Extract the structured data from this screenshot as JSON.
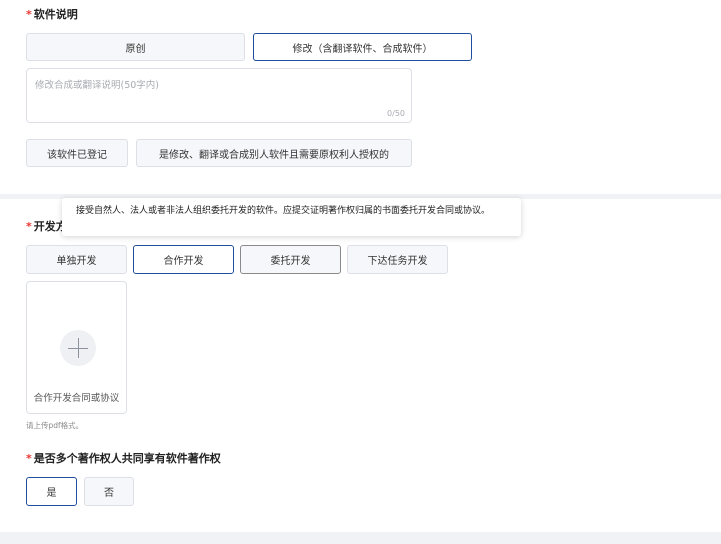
{
  "software_desc": {
    "label": "软件说明",
    "required_mark": "*",
    "options": [
      "原创",
      "修改（含翻译软件、合成软件）"
    ],
    "selected": "修改（含翻译软件、合成软件）",
    "textarea": {
      "placeholder": "修改合成或翻译说明(50字内)",
      "counter": "0/50"
    },
    "extra_options": [
      "该软件已登记",
      "是修改、翻译或合成别人软件且需要原权利人授权的"
    ]
  },
  "dev_method": {
    "label_visible": "开发方",
    "required_mark": "*",
    "tooltip": "接受自然人、法人或者非法人组织委托开发的软件。应提交证明著作权归属的书面委托开发合同或协议。",
    "options": [
      "单独开发",
      "合作开发",
      "委托开发",
      "下达任务开发"
    ],
    "selected": "合作开发",
    "hovered": "委托开发",
    "upload": {
      "caption": "合作开发合同或协议"
    },
    "hint": "请上传pdf格式。"
  },
  "shared_copyright": {
    "label": "是否多个著作权人共同享有软件著作权",
    "required_mark": "*",
    "options": [
      "是",
      "否"
    ],
    "selected": "是"
  },
  "colors": {
    "accent_border": "#1f4e9e",
    "required": "#e53935",
    "option_bg": "#f5f7fa",
    "page_bg": "#f0f2f5"
  },
  "icons": {
    "upload": "plus-icon"
  }
}
